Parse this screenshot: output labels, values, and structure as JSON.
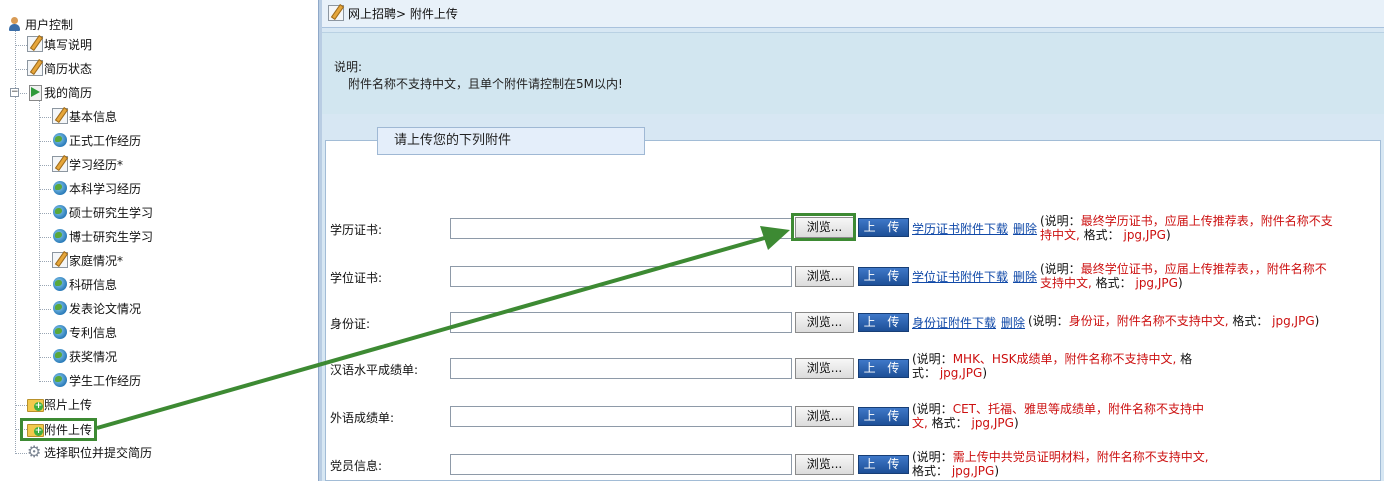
{
  "sidebar": {
    "root": "用户控制",
    "items": [
      {
        "label": "填写说明",
        "icon": "edit-icon"
      },
      {
        "label": "简历状态",
        "icon": "edit-icon"
      },
      {
        "label": "我的简历",
        "icon": "play-doc-icon"
      },
      {
        "label": "基本信息",
        "icon": "edit-icon"
      },
      {
        "label": "正式工作经历",
        "icon": "globe-icon"
      },
      {
        "label": "学习经历*",
        "icon": "edit-icon"
      },
      {
        "label": "本科学习经历",
        "icon": "globe-icon"
      },
      {
        "label": "硕士研究生学习",
        "icon": "globe-icon"
      },
      {
        "label": "博士研究生学习",
        "icon": "globe-icon"
      },
      {
        "label": "家庭情况*",
        "icon": "edit-icon"
      },
      {
        "label": "科研信息",
        "icon": "globe-icon"
      },
      {
        "label": "发表论文情况",
        "icon": "globe-icon"
      },
      {
        "label": "专利信息",
        "icon": "globe-icon"
      },
      {
        "label": "获奖情况",
        "icon": "globe-icon"
      },
      {
        "label": "学生工作经历",
        "icon": "globe-icon"
      },
      {
        "label": "照片上传",
        "icon": "folder-add-icon"
      },
      {
        "label": "附件上传",
        "icon": "folder-add-icon"
      },
      {
        "label": "选择职位并提交简历",
        "icon": "gear-icon"
      }
    ]
  },
  "header": {
    "breadcrumb": "网上招聘> 附件上传"
  },
  "notice": {
    "title": "说明:",
    "text": "附件名称不支持中文，且单个附件请控制在5M以内!"
  },
  "form": {
    "legend": "请上传您的下列附件",
    "browse_label": "浏览...",
    "upload_label": "上 传",
    "delete_label": "删除",
    "rows": [
      {
        "label": "学历证书:",
        "download": "学历证书附件下载",
        "note_prefix": "(说明：",
        "note_red1": "最终学历证书，应届上传推荐表，附件名称不支",
        "note_red2": "持中文,",
        "note_mid": " 格式：",
        "note_red3": "jpg,JPG",
        "note_suffix": ")"
      },
      {
        "label": "学位证书:",
        "download": "学位证书附件下载",
        "note_prefix": "(说明：",
        "note_red1": "最终学位证书，应届上传推荐表，，附件名称不",
        "note_red2": "支持中文,",
        "note_mid": " 格式：",
        "note_red3": "jpg,JPG",
        "note_suffix": ")"
      },
      {
        "label": "身份证:",
        "download": "身份证附件下载",
        "note_prefix": "(说明：",
        "note_red1": "身份证，附件名称不支持中文,",
        "note_mid": " 格式：",
        "note_red3": "jpg,JPG",
        "note_suffix": ")"
      },
      {
        "label": "汉语水平成绩单:",
        "note_prefix": "(说明：",
        "note_red1": "MHK、HSK成绩单，附件名称不支持中文,",
        "note_mid1": " 格",
        "note_mid2": "式：",
        "note_red3": "jpg,JPG",
        "note_suffix": ")"
      },
      {
        "label": "外语成绩单:",
        "note_prefix": "(说明：",
        "note_red1": "CET、托福、雅思等成绩单，附件名称不支持中",
        "note_red2": "文,",
        "note_mid": " 格式：",
        "note_red3": "jpg,JPG",
        "note_suffix": ")"
      },
      {
        "label": "党员信息:",
        "note_prefix": "(说明：",
        "note_red1": "需上传中共党员证明材料，附件名称不支持中文,",
        "note_mid": "格式：",
        "note_red3": "jpg,JPG",
        "note_suffix": ")"
      }
    ]
  },
  "colors": {
    "annotation_green": "#3d8a33",
    "note_red": "#cc1010",
    "link_blue": "#1049a8",
    "upload_blue": "#2a60ad"
  }
}
